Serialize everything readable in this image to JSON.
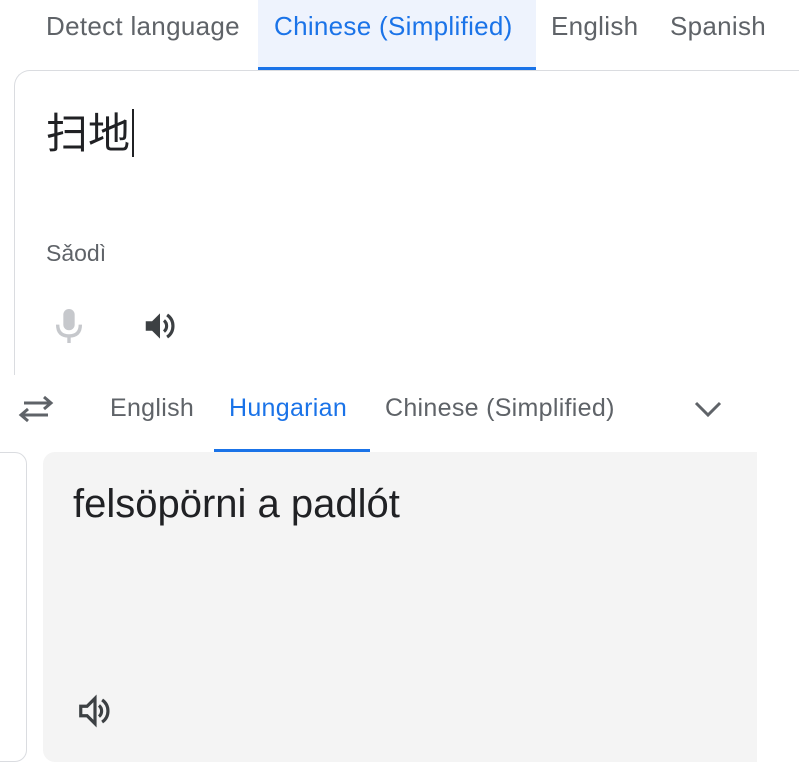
{
  "source_tabs": {
    "detect": "Detect language",
    "chinese_simplified": "Chinese (Simplified)",
    "english": "English",
    "spanish": "Spanish"
  },
  "source": {
    "text": "扫地",
    "transliteration": "Sǎodì"
  },
  "target_tabs": {
    "english": "English",
    "hungarian": "Hungarian",
    "chinese_simplified": "Chinese (Simplified)"
  },
  "target": {
    "text": "felsöpörni a padlót"
  },
  "colors": {
    "accent": "#1a73e8",
    "tab_active_bg": "#eef3fd",
    "target_bg": "#f4f4f4",
    "muted": "#5f6368"
  },
  "icons": {
    "mic": "mic-icon",
    "speaker": "speaker-icon",
    "swap": "swap-icon",
    "more": "chevron-down-icon"
  }
}
